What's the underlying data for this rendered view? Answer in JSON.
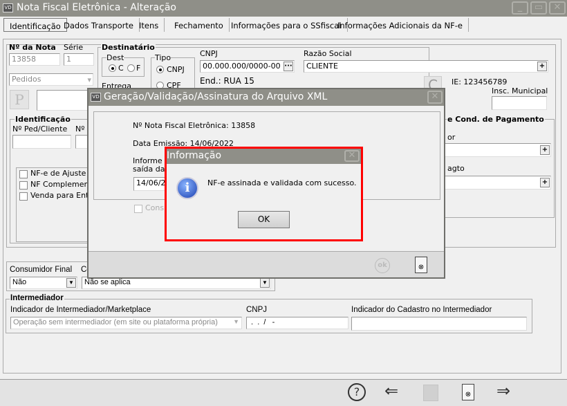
{
  "window": {
    "title": "Nota Fiscal Eletrônica - Alteração",
    "logo": "VD",
    "controls": [
      "minimize",
      "maximize",
      "close"
    ]
  },
  "tabs": [
    "Identificação",
    "Dados Transporte",
    "Itens",
    "Fechamento",
    "Informações para o SSfiscal",
    "Informações Adicionais da NF-e"
  ],
  "form": {
    "nota_label": "Nº da Nota",
    "nota_value": "13858",
    "serie_label": "Série",
    "serie_value": "1",
    "origem_select": "Pedidos",
    "p_button": "P",
    "destinatario": {
      "legend": "Destinatário",
      "dest_legend": "Dest",
      "dest_options": [
        "C",
        "F"
      ],
      "tipo_legend": "Tipo",
      "tipo_options": [
        "CNPJ",
        "CPF"
      ],
      "entrega_label": "Entrega",
      "cnpj_label": "CNPJ",
      "cnpj_value": "00.000.000/0000-00",
      "razao_label": "Razão Social",
      "razao_value": "CLIENTE",
      "endereco": "End.: RUA 15",
      "c_button": "C",
      "ie": "IE: 123456789",
      "insc_municipal_label": "Insc. Municipal",
      "insc_municipal_value": ""
    },
    "identificacao": {
      "legend": "Identificação",
      "ped_cliente_label": "Nº Ped/Cliente",
      "second_label": "Nº P"
    },
    "checkboxes": [
      "NF-e de Ajuste",
      "NF Complementa",
      "Venda para Entre"
    ],
    "pagamento": {
      "legend": "e Cond. de Pagamento",
      "label1": "or",
      "label2": "agto"
    },
    "consumidor_final_label": "Consumidor Final",
    "consumidor_final_value": "Não",
    "second_select_label": "Co",
    "second_select_value": "Não se aplica",
    "intermediador": {
      "legend": "Intermediador",
      "indicador_label": "Indicador de Intermediador/Marketplace",
      "indicador_value": "Operação sem intermediador (em site ou plataforma própria)",
      "cnpj_label": "CNPJ",
      "cnpj_value": " .  .  /   -",
      "cadastro_label": "Indicador do Cadastro no Intermediador",
      "cadastro_value": ""
    }
  },
  "xml_dialog": {
    "title": "Geração/Validação/Assinatura do Arquivo XML",
    "nota_line": "Nº Nota Fiscal Eletrônica:  13858",
    "data_line": "Data Emissão: 14/06/2022",
    "informe_line1": "Informe a",
    "informe_line2": "saída da N",
    "date_value": "14/06/20",
    "checkbox_label": "Consi"
  },
  "info_dialog": {
    "title": "Informação",
    "message": "NF-e assinada e validada com sucesso.",
    "ok": "OK",
    "highlight_color": "#ff0000"
  },
  "toolbar": {
    "icons": [
      "help-icon",
      "back-arrow-icon",
      "save-icon",
      "cancel-document-icon",
      "forward-arrow-icon"
    ]
  }
}
